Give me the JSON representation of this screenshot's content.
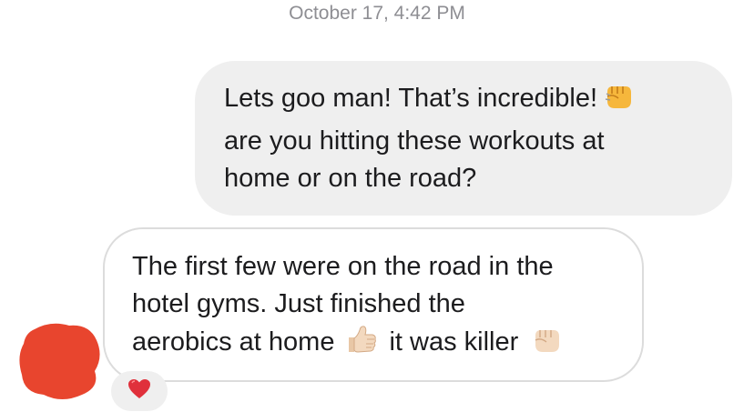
{
  "timestamp": "October 17, 4:42 PM",
  "outgoing_message": {
    "lines": [
      "Lets goo man! That’s incredible!",
      "are you hitting these workouts at",
      "home or on the road?"
    ],
    "emojis": [
      "fist-bump-emoji"
    ]
  },
  "incoming_message": {
    "lines": [
      "The first few were on the road in the",
      "hotel gyms. Just finished the",
      "aerobics at home",
      "it was killer"
    ],
    "emojis": [
      "thumbs-up-emoji",
      "fist-bump-emoji"
    ]
  },
  "reaction": {
    "icon": "red-heart-icon"
  },
  "colors": {
    "outgoing_bubble": "#efefef",
    "incoming_border": "#dcdcdc",
    "avatar_redaction": "#e8452e",
    "timestamp_text": "#8e8e93",
    "heart": "#e0303b"
  }
}
